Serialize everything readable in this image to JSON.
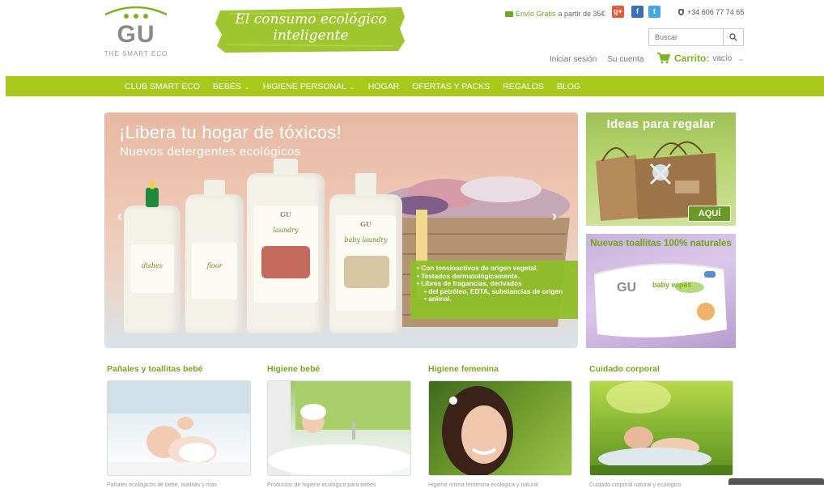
{
  "header": {
    "logo_letters": "GU",
    "logo_tagline": "THE SMART ECO",
    "slogan_line1": "El consumo ecológico",
    "slogan_line2": "inteligente",
    "free_shipping_highlight": "Envío Gratis",
    "free_shipping_rest": "a partir de 35€",
    "social": {
      "googleplus": "g+",
      "facebook": "f",
      "twitter": "t"
    },
    "phone": "+34 606 77 74 65",
    "search_placeholder": "Buscar",
    "login": "Iniciar sesión",
    "account": "Su cuenta",
    "cart_label": "Carrito:",
    "cart_state": "vacío"
  },
  "nav": {
    "items": [
      {
        "label": "CLUB SMART ECO",
        "dropdown": false
      },
      {
        "label": "BEBÉS",
        "dropdown": true
      },
      {
        "label": "HIGIENE PERSONAL",
        "dropdown": true
      },
      {
        "label": "HOGAR",
        "dropdown": false
      },
      {
        "label": "OFERTAS Y PACKS",
        "dropdown": false
      },
      {
        "label": "REGALOS",
        "dropdown": false
      },
      {
        "label": "BLOG",
        "dropdown": false
      }
    ],
    "caret": "⌄"
  },
  "hero": {
    "title": "¡Libera tu hogar de tóxicos!",
    "subtitle": "Nuevos detergentes ecológicos",
    "prev": "‹",
    "next": "›",
    "bottle_labels": [
      "dishes",
      "floor",
      "laundry",
      "baby laundry"
    ],
    "bottle_brand": "GU",
    "bullets": [
      "Con tensioactivos de origen vegetal.",
      "Testados dermatológicamente.",
      "Libres de fragancias, derivados",
      "del petróleo, EDTA, substancias de origen",
      "animal."
    ]
  },
  "side_banners": {
    "gifts_title": "Ideas para regalar",
    "gifts_button": "AQUÍ",
    "wipes_title": "Nuevas toallitas 100% naturales",
    "wipes_brand": "GU",
    "wipes_product": "baby wipes"
  },
  "categories": [
    {
      "title": "Pañales y toallitas bebé",
      "desc": "Pañales ecológicos de bebé, toallitas y más"
    },
    {
      "title": "Higiene bebé",
      "desc": "Productos de higiene ecológica para bebés"
    },
    {
      "title": "Higiene femenina",
      "desc": "Higiene íntima femenina ecológica y natural"
    },
    {
      "title": "Cuidado corporal",
      "desc": "Cuidado corporal natural y ecológico"
    }
  ],
  "colors": {
    "brand_green": "#a8c81b",
    "text_green": "#7aa51d",
    "cart_green": "#7ab51d"
  }
}
